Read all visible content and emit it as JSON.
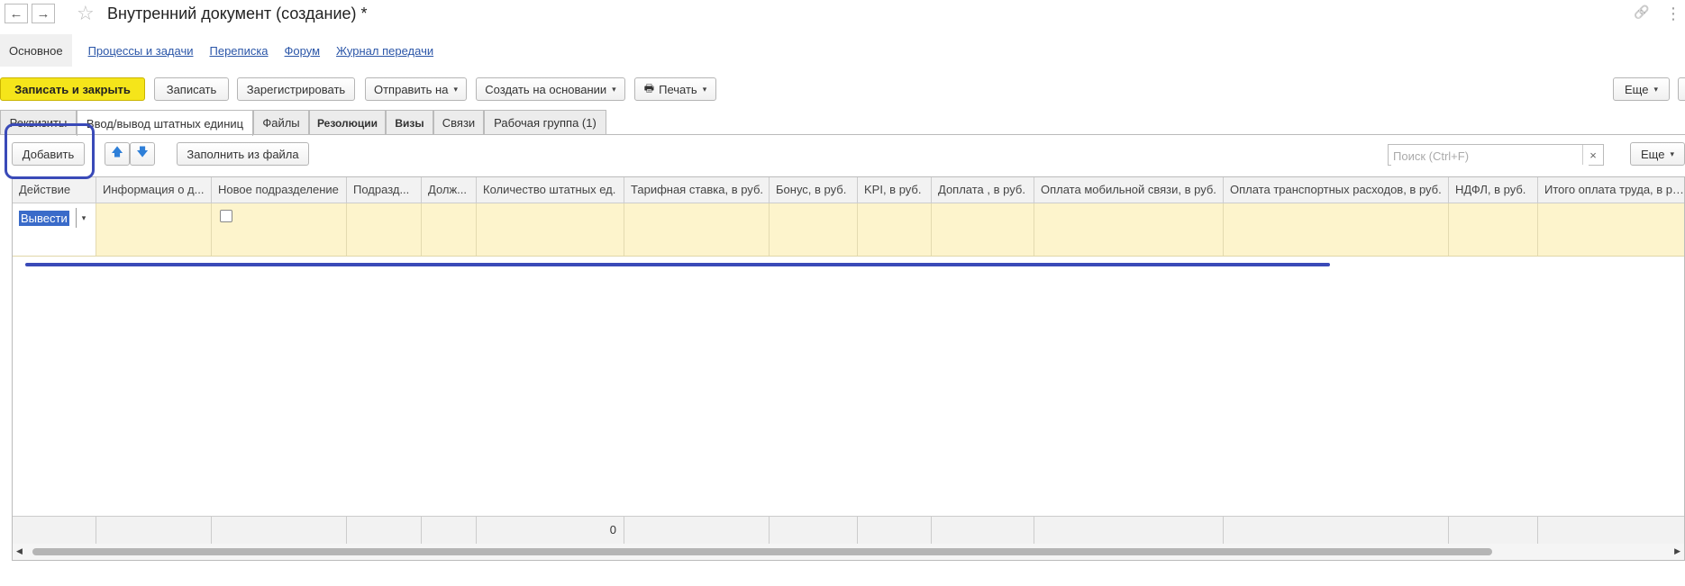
{
  "header": {
    "title": "Внутренний документ (создание) *",
    "back_icon": "←",
    "forward_icon": "→",
    "star_icon": "☆",
    "link_icon": "🔗",
    "menu_icon": "⋮"
  },
  "topnav": {
    "current": "Основное",
    "links": [
      "Процессы и задачи",
      "Переписка",
      "Форум",
      "Журнал передачи"
    ]
  },
  "toolbar": {
    "save_close": "Записать и закрыть",
    "save": "Записать",
    "register": "Зарегистрировать",
    "send_to": "Отправить на",
    "create_based": "Создать на основании",
    "print": "Печать",
    "more": "Еще",
    "caret": "▾",
    "print_icon": "🖶"
  },
  "tabs": [
    "Реквизиты",
    "Ввод/вывод штатных единиц",
    "Файлы",
    "Резолюции",
    "Визы",
    "Связи",
    "Рабочая группа (1)"
  ],
  "subtoolbar": {
    "add": "Добавить",
    "up_icon": "🡅",
    "down_icon": "🡇",
    "fill_from_file": "Заполнить из файла",
    "search_placeholder": "Поиск (Ctrl+F)",
    "clear_icon": "×",
    "more": "Еще"
  },
  "table": {
    "columns": [
      "Действие",
      "Информация о д...",
      "Новое подразделение",
      "Подразд...",
      "Долж...",
      "Количество штатных ед.",
      "Тарифная ставка, в руб.",
      "Бонус, в руб.",
      "KPI, в руб.",
      "Доплата , в руб.",
      "Оплата мобильной связи, в руб.",
      "Оплата транспортных расходов, в руб.",
      "НДФЛ, в руб.",
      "Итого оплата труда, в руб."
    ],
    "row": {
      "action": "Вывести",
      "dd_icon": "▾"
    },
    "footer_total": "0"
  },
  "colors": {
    "primary": "#f5e51a",
    "row_highlight": "#fdf4cc",
    "link": "#2b56a8",
    "annotation": "#3a4ab8"
  }
}
